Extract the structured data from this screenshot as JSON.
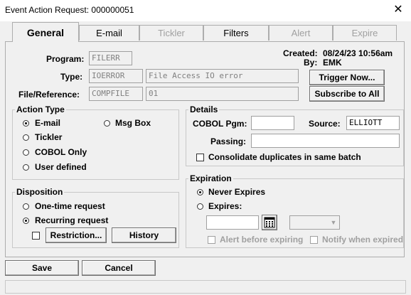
{
  "window": {
    "title": "Event Action Request: 000000051",
    "close_glyph": "✕"
  },
  "tabs": [
    {
      "label": "General",
      "state": "active"
    },
    {
      "label": "E-mail",
      "state": "normal"
    },
    {
      "label": "Tickler",
      "state": "disabled"
    },
    {
      "label": "Filters",
      "state": "normal"
    },
    {
      "label": "Alert",
      "state": "disabled"
    },
    {
      "label": "Expire",
      "state": "disabled"
    }
  ],
  "form": {
    "program_label": "Program:",
    "program_value": "FILERR",
    "type_label": "Type:",
    "type_code": "IOERROR",
    "type_desc": "File Access IO error",
    "fileref_label": "File/Reference:",
    "fileref_value": "COMPFILE",
    "fileref_sub": "01"
  },
  "meta": {
    "created_label": "Created:",
    "created_value": "08/24/23 10:56am",
    "by_label": "By:",
    "by_value": "EMK"
  },
  "buttons": {
    "trigger_now": "Trigger Now...",
    "subscribe_all": "Subscribe to All",
    "restriction": "Restriction...",
    "history": "History",
    "save": "Save",
    "cancel": "Cancel"
  },
  "action_type": {
    "legend": "Action Type",
    "options": [
      {
        "label": "E-mail",
        "selected": true
      },
      {
        "label": "Msg Box",
        "selected": false
      },
      {
        "label": "Tickler",
        "selected": false
      },
      {
        "label": "COBOL Only",
        "selected": false
      },
      {
        "label": "User defined",
        "selected": false
      }
    ]
  },
  "disposition": {
    "legend": "Disposition",
    "options": [
      {
        "label": "One-time request",
        "selected": false
      },
      {
        "label": "Recurring request",
        "selected": true
      }
    ]
  },
  "details": {
    "legend": "Details",
    "cobol_pgm_label": "COBOL Pgm:",
    "cobol_pgm_value": "",
    "source_label": "Source:",
    "source_value": "ELLIOTT",
    "passing_label": "Passing:",
    "passing_value": "",
    "consolidate_label": "Consolidate duplicates in same batch"
  },
  "expiration": {
    "legend": "Expiration",
    "never_label": "Never Expires",
    "expires_label": "Expires:",
    "date_value": "",
    "time_value": "",
    "alert_label": "Alert before expiring",
    "notify_label": "Notify when expired"
  },
  "icons": {
    "calendar": "calendar-icon",
    "dropdown": "chevron-down-icon"
  }
}
